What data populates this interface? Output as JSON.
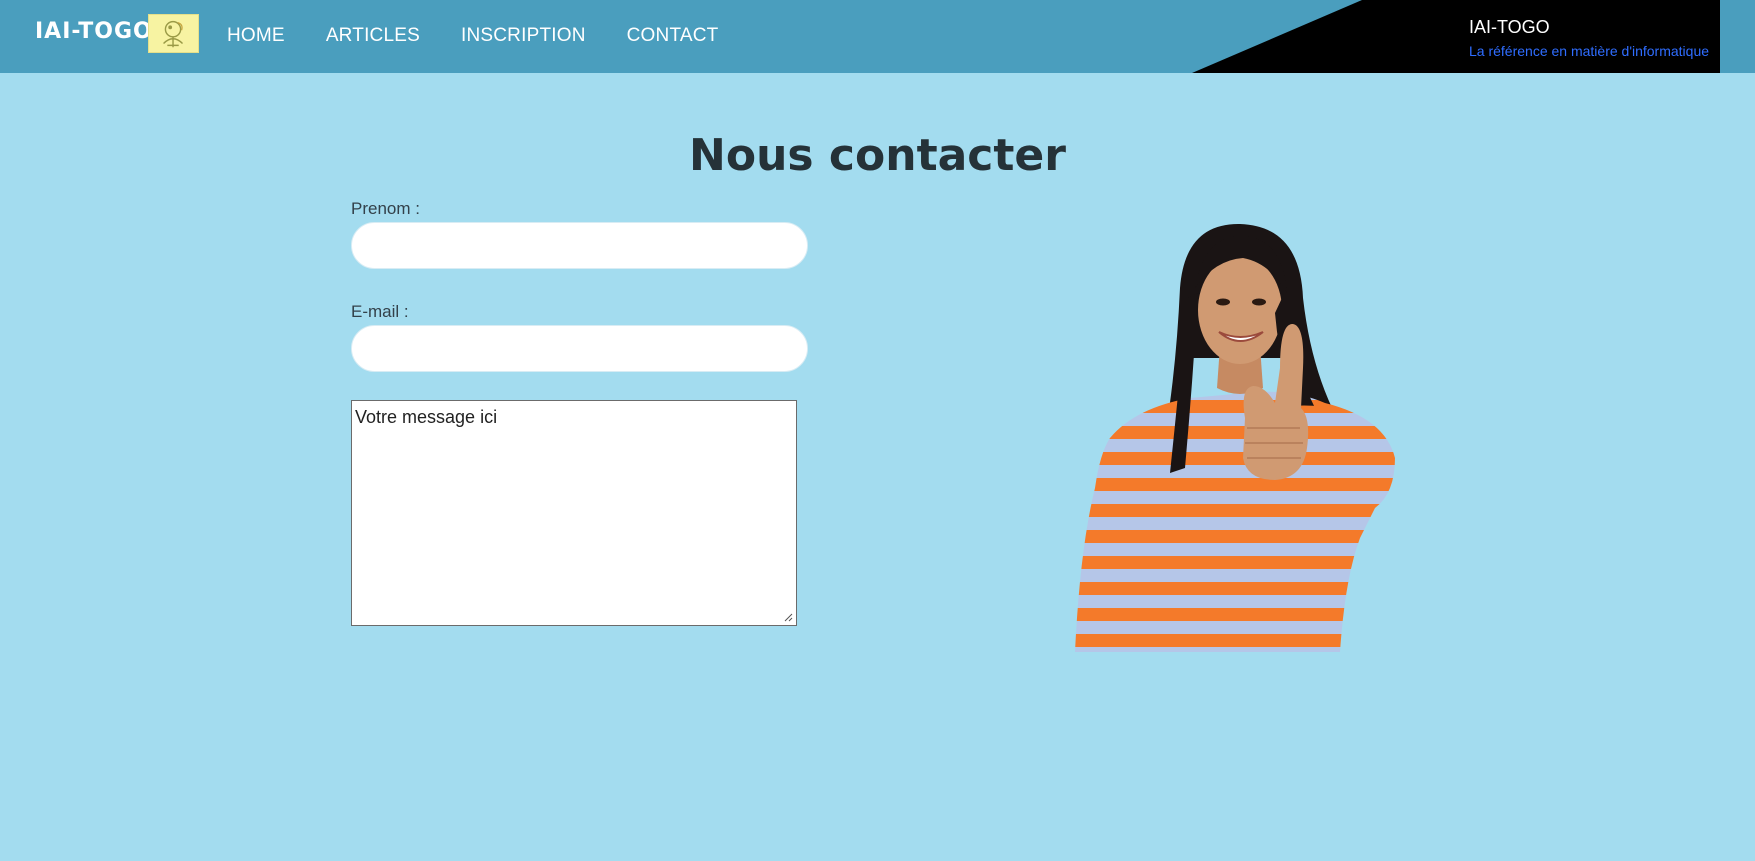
{
  "header": {
    "brand": "IAI-TOGO",
    "nav": [
      "HOME",
      "ARTICLES",
      "INSCRIPTION",
      "CONTACT"
    ],
    "corner_title": "IAI-TOGO",
    "corner_tagline": "La référence en matière d'informatique"
  },
  "main": {
    "title": "Nous contacter",
    "prenom_label": "Prenom :",
    "prenom_value": "",
    "email_label": "E-mail :",
    "email_value": "",
    "message_value": "Votre message ici"
  },
  "colors": {
    "page_bg": "#a3dcef",
    "header_bg": "#4a9ebe",
    "corner_bg": "#000000",
    "tagline": "#2f6dff"
  },
  "icons": {
    "logo": "iai-logo-icon",
    "photo": "woman-thumbs-up-photo"
  }
}
